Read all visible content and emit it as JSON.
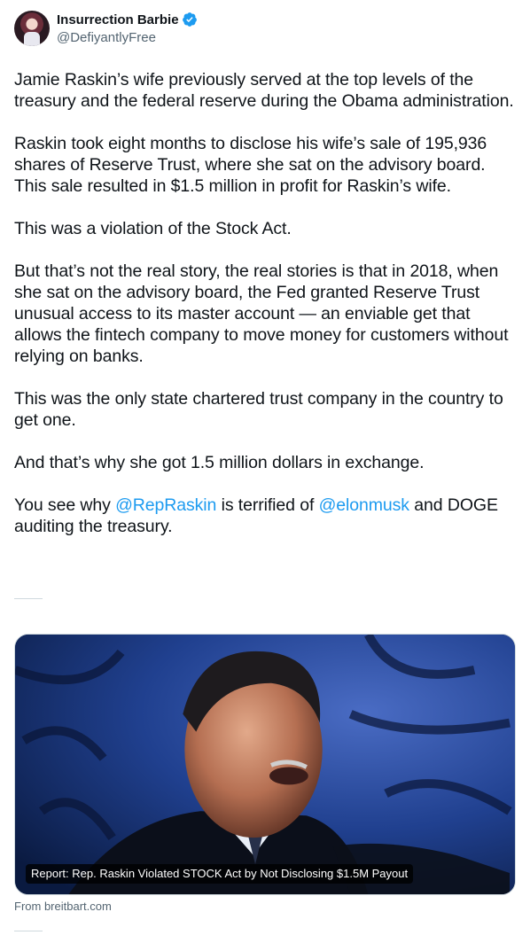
{
  "author": {
    "display_name": "Insurrection Barbie",
    "handle": "@DefiyantlyFree",
    "verified": true
  },
  "tweet": {
    "paragraphs": [
      "Jamie Raskin’s wife previously served at the top levels of the treasury and the federal reserve during the Obama administration.",
      "Raskin took eight months to disclose his wife’s sale of 195,936 shares of Reserve Trust, where she sat on the advisory board. This sale resulted in $1.5 million in profit for Raskin’s wife.",
      "This was a violation of the Stock Act.",
      "But that’s not the real story, the real stories is that in 2018, when she sat on the advisory board, the Fed granted Reserve Trust unusual access to its master account — an enviable get that allows the fintech company to move money for customers without relying on banks.",
      "This was the only state chartered trust company in the country to get one.",
      "And that’s why she got 1.5 million dollars in exchange."
    ],
    "last_paragraph": {
      "part1": "You see why ",
      "mention1": "@RepRaskin",
      "part2": " is terrified of ",
      "mention2": "@elonmusk",
      "part3": " and DOGE auditing the treasury."
    }
  },
  "card": {
    "caption": "Report: Rep. Raskin Violated STOCK Act by Not Disclosing $1.5M Payout",
    "source": "From breitbart.com"
  },
  "colors": {
    "link": "#1d9bf0",
    "text": "#0f1419",
    "secondary": "#536471"
  }
}
